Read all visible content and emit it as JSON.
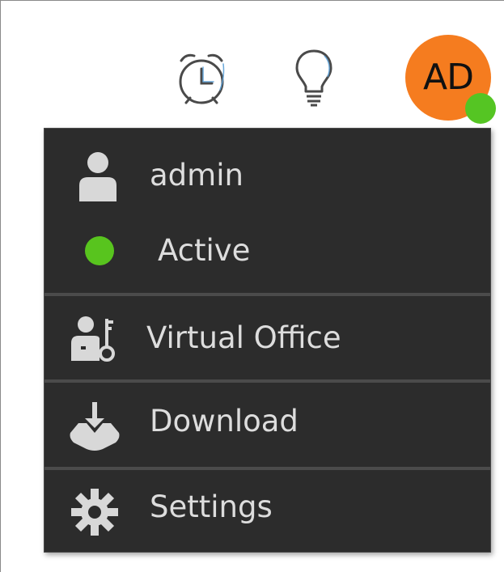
{
  "header": {
    "alarm_icon": "alarm-clock-icon",
    "bulb_icon": "lightbulb-icon",
    "avatar": {
      "initials": "AD",
      "color": "#f57c1f",
      "presence_color": "#55c523"
    }
  },
  "menu": {
    "user": {
      "name": "admin",
      "icon": "user-icon"
    },
    "status": {
      "label": "Active",
      "color": "#58c41e"
    },
    "items": [
      {
        "label": "Virtual Office",
        "icon": "user-key-icon"
      },
      {
        "label": "Download",
        "icon": "download-icon"
      },
      {
        "label": "Settings",
        "icon": "gear-icon"
      }
    ],
    "colors": {
      "background": "#2c2c2c",
      "text": "#dddddd",
      "icon": "#d8d8d8",
      "divider": "#4b4b4b"
    }
  }
}
